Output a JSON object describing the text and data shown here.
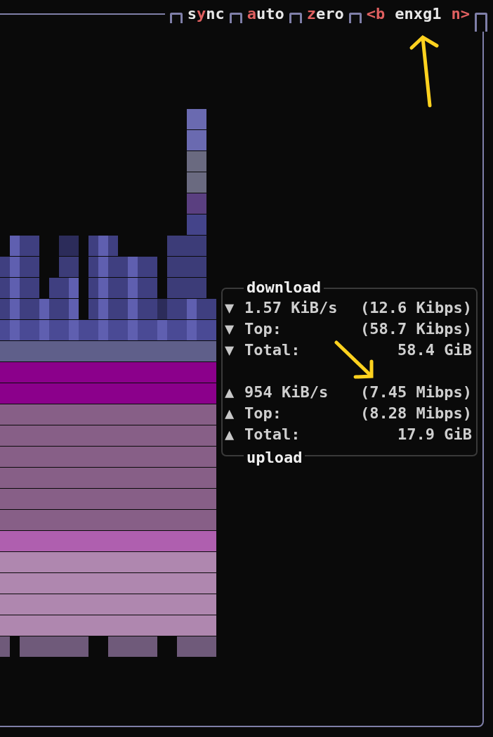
{
  "toolbar": {
    "buttons": [
      {
        "parts": [
          {
            "text": "s",
            "hotkey": false
          },
          {
            "text": "y",
            "hotkey": true
          },
          {
            "text": "nc",
            "hotkey": false
          }
        ]
      },
      {
        "parts": [
          {
            "text": "a",
            "hotkey": true
          },
          {
            "text": "uto",
            "hotkey": false
          }
        ]
      },
      {
        "parts": [
          {
            "text": "z",
            "hotkey": true
          },
          {
            "text": "ero",
            "hotkey": false
          }
        ]
      }
    ],
    "interface": {
      "prev": "<b",
      "name": "enxg1",
      "next": "n>"
    }
  },
  "stats": {
    "download_title": "download",
    "upload_title": "upload",
    "sections": [
      {
        "rows": [
          {
            "arrow": "▼",
            "label": "1.57 KiB/s",
            "value": "(12.6 Kibps)"
          },
          {
            "arrow": "▼",
            "label": "Top:",
            "value": "(58.7 Kibps)"
          },
          {
            "arrow": "▼",
            "label": "Total:",
            "value": "58.4 GiB"
          }
        ]
      },
      {
        "rows": [
          {
            "arrow": "▲",
            "label": "954 KiB/s",
            "value": "(7.45 Mibps)"
          },
          {
            "arrow": "▲",
            "label": "Top:",
            "value": "(8.28 Mibps)"
          },
          {
            "arrow": "▲",
            "label": "Total:",
            "value": "17.9 GiB"
          }
        ]
      }
    ]
  }
}
